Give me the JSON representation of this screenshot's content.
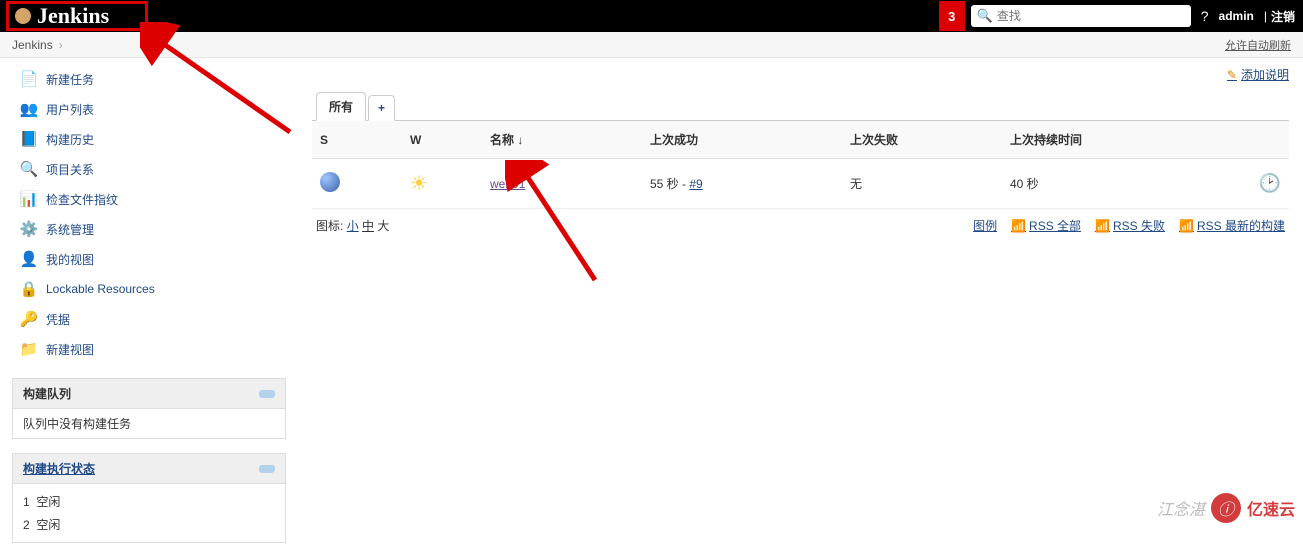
{
  "header": {
    "brand": "Jenkins",
    "alert_count": "3",
    "search_placeholder": "查找",
    "help_label": "?",
    "username": "admin",
    "divider": "|",
    "logout_label": "注销"
  },
  "breadcrumb": {
    "root": "Jenkins",
    "auto_refresh": "允许自动刷新"
  },
  "sidebar": {
    "items": [
      {
        "icon": "📄",
        "label": "新建任务"
      },
      {
        "icon": "👥",
        "label": "用户列表"
      },
      {
        "icon": "📘",
        "label": "构建历史"
      },
      {
        "icon": "🔍",
        "label": "项目关系"
      },
      {
        "icon": "📊",
        "label": "检查文件指纹"
      },
      {
        "icon": "⚙️",
        "label": "系统管理"
      },
      {
        "icon": "👤",
        "label": "我的视图"
      },
      {
        "icon": "🔒",
        "label": "Lockable Resources"
      },
      {
        "icon": "🔑",
        "label": "凭据"
      },
      {
        "icon": "📁",
        "label": "新建视图"
      }
    ],
    "build_queue": {
      "title": "构建队列",
      "empty": "队列中没有构建任务"
    },
    "executors": {
      "title": "构建执行状态",
      "rows": [
        {
          "num": "1",
          "state": "空闲"
        },
        {
          "num": "2",
          "state": "空闲"
        }
      ]
    }
  },
  "main": {
    "add_description": "添加说明",
    "tabs": {
      "all": "所有",
      "add": "+"
    },
    "columns": {
      "s": "S",
      "w": "W",
      "name": "名称 ↓",
      "last_success": "上次成功",
      "last_failure": "上次失败",
      "last_duration": "上次持续时间"
    },
    "rows": [
      {
        "name": "web01",
        "last_success_time": "55 秒 - ",
        "last_success_build": "#9",
        "last_failure": "无",
        "last_duration": "40 秒"
      }
    ],
    "icon_size": {
      "label": "图标:",
      "small": "小",
      "medium": "中",
      "large": "大"
    },
    "rss": {
      "legend": "图例",
      "all": "RSS 全部",
      "fail": "RSS 失败",
      "latest": "RSS 最新的构建"
    }
  },
  "watermark": "江念湛",
  "ys": "亿速云"
}
